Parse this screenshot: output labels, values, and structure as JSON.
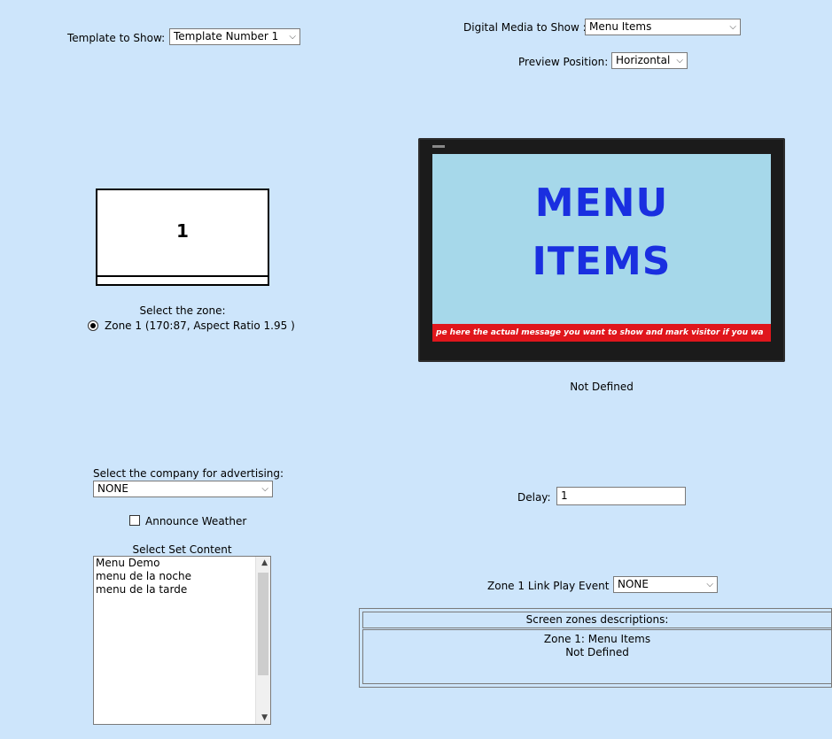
{
  "template": {
    "label": "Template to Show:",
    "value": "Template Number 1",
    "zone_number": "1"
  },
  "digital_media": {
    "label": "Digital Media to Show :",
    "value": "Menu Items"
  },
  "preview_position": {
    "label": "Preview Position:",
    "value": "Horizontal"
  },
  "zone_select": {
    "title": "Select the zone:",
    "option": "Zone 1 (170:87, Aspect Ratio 1.95 )"
  },
  "tv_preview": {
    "line1": "MENU",
    "line2": "ITEMS",
    "ticker": "pe here the actual message you want to show and mark visitor if you wa",
    "status": "Not Defined"
  },
  "advertising": {
    "label": "Select the company for advertising:",
    "value": "NONE"
  },
  "weather": {
    "label": "Announce Weather",
    "checked": false
  },
  "set_content": {
    "title": "Select Set Content",
    "items": [
      "Menu Demo",
      "menu de la noche",
      "menu de la tarde"
    ]
  },
  "delay": {
    "label": "Delay:",
    "value": "1"
  },
  "link_play": {
    "label": "Zone 1 Link Play Event :",
    "value": "NONE"
  },
  "zones_desc": {
    "header": "Screen zones descriptions:",
    "line1": "Zone 1: Menu Items",
    "line2": "Not Defined"
  },
  "icons": {
    "dropdown": "chevron-down-icon"
  }
}
